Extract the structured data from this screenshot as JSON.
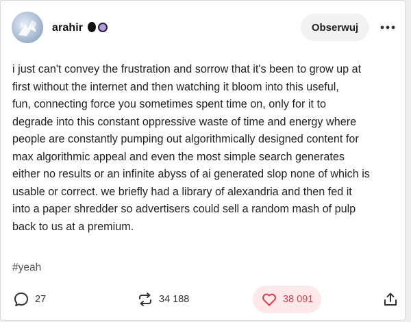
{
  "post": {
    "author": {
      "username": "arahir",
      "avatar_icon": "avatar-image"
    },
    "follow_label": "Obserwuj",
    "more_icon": "more-dots-icon",
    "body_lines": [
      "i just can't convey the frustration and sorrow that it's been to grow up at",
      "first without the internet and then watching it bloom into this useful,",
      "fun, connecting force you sometimes spent time on, only for it to",
      "degrade into this constant oppressive waste of time and energy where",
      "people are constantly pumping out algorithmically designed content for",
      "max algorithmic appeal and even the most simple search generates",
      "either no results or an infinite abyss of ai generated slop none of which is",
      "usable or correct. we briefly had a library of alexandria and then fed it",
      "into a paper shredder so advertisers could sell a random mash of pulp",
      "back to us at a premium."
    ],
    "tag": "#yeah",
    "actions": {
      "replies": {
        "count": "27",
        "icon": "comment-icon"
      },
      "reblogs": {
        "count": "34 188",
        "icon": "reblog-icon"
      },
      "likes": {
        "count": "38 091",
        "icon": "heart-icon",
        "active": true
      },
      "share": {
        "icon": "share-icon"
      }
    }
  },
  "colors": {
    "like_active": "#e23a4a",
    "like_bg": "#fde8ea",
    "follow_bg": "#f2f2f2"
  }
}
